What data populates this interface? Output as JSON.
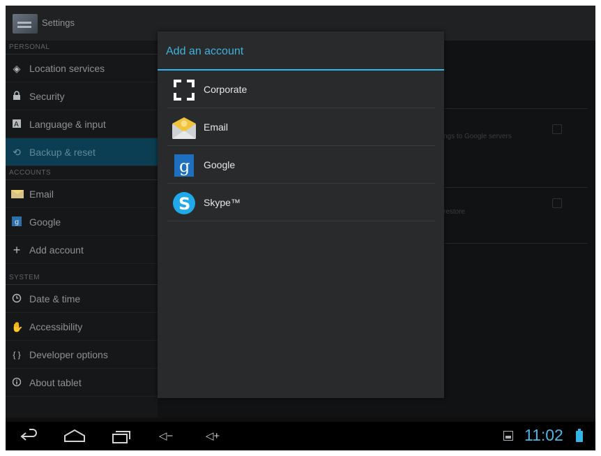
{
  "action_bar": {
    "title": "Settings",
    "icon": "settings-icon"
  },
  "sidebar": {
    "sections": [
      {
        "header": "PERSONAL"
      },
      {
        "header": "ACCOUNTS"
      },
      {
        "header": "SYSTEM"
      }
    ],
    "items": [
      {
        "label": "Location services",
        "icon": "location-icon"
      },
      {
        "label": "Security",
        "icon": "lock-icon"
      },
      {
        "label": "Language & input",
        "icon": "keyboard-icon"
      },
      {
        "label": "Backup & reset",
        "icon": "restore-icon",
        "selected": true
      },
      {
        "label": "Email",
        "icon": "email-icon"
      },
      {
        "label": "Google",
        "icon": "google-icon"
      },
      {
        "label": "Add account",
        "icon": "plus-icon"
      },
      {
        "label": "Date & time",
        "icon": "clock-icon"
      },
      {
        "label": "Accessibility",
        "icon": "hand-icon"
      },
      {
        "label": "Developer options",
        "icon": "braces-icon"
      },
      {
        "label": "About tablet",
        "icon": "info-icon"
      }
    ]
  },
  "right_panel": {
    "ghost_text_1": "ngs to Google servers",
    "ghost_text_2": "restore"
  },
  "dialog": {
    "title": "Add an account",
    "accounts": [
      {
        "label": "Corporate",
        "icon": "corporate-icon"
      },
      {
        "label": "Email",
        "icon": "envelope-icon"
      },
      {
        "label": "Google",
        "icon": "google-icon"
      },
      {
        "label": "Skype™",
        "icon": "skype-icon"
      }
    ]
  },
  "nav_bar": {
    "clock": "11:02",
    "back_glyph": "⮌",
    "vol_down": "◁−",
    "vol_up": "◁+"
  },
  "colors": {
    "accent": "#33b5e5",
    "selected_bg": "#0b3e52",
    "dialog_bg": "#282a2c"
  }
}
